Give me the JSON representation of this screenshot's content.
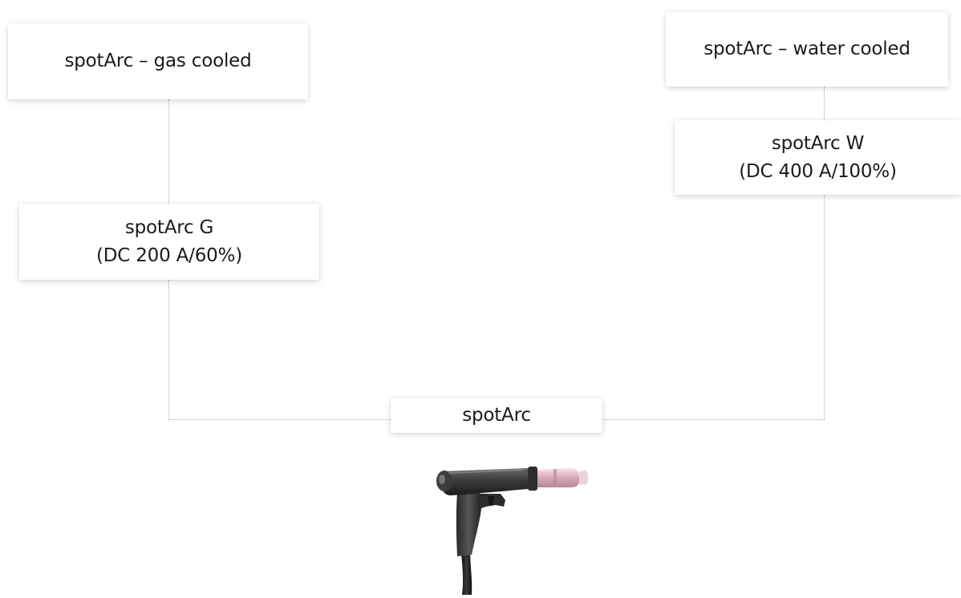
{
  "diagram": {
    "type": "tree",
    "root": {
      "label": "spotArc"
    },
    "branches": [
      {
        "group_label": "spotArc – gas cooled",
        "model": {
          "name": "spotArc G",
          "spec": "(DC 200 A/60%)"
        }
      },
      {
        "group_label": "spotArc – water cooled",
        "model": {
          "name": "spotArc W",
          "spec": "(DC 400 A/100%)"
        }
      }
    ],
    "connector_style": "dotted",
    "connector_color": "#a8a8a8",
    "image": {
      "icon": "welding-torch-icon"
    }
  }
}
